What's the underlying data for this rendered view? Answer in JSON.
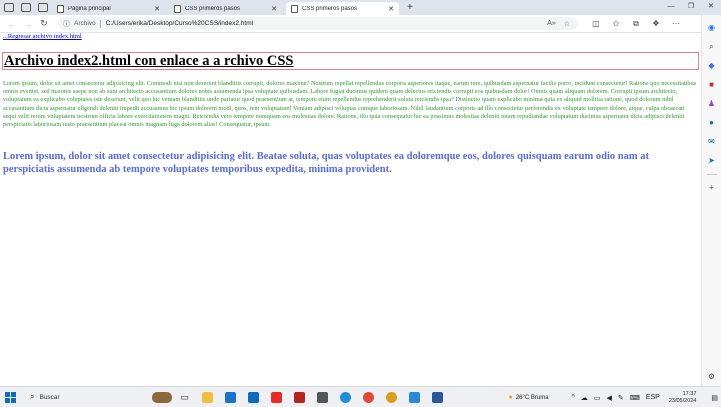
{
  "browser": {
    "tabs": [
      {
        "label": "Página principal",
        "active": false
      },
      {
        "label": "CSS primeros pasos",
        "active": false
      },
      {
        "label": "CSS primeros pasos",
        "active": true
      }
    ],
    "address": {
      "site_label": "Archivo",
      "url": "C:/Users/erika/Desktop/Curso%20CSS/index2.html"
    }
  },
  "page": {
    "back_link": "...Regresar archivo index.html",
    "heading": "Archivo index2.html con enlace a a rchivo CSS",
    "paragraph_green": "Lorem ipsum, dolor sit amet consectetur adipisicing elit. Commodi nisi non deserunt blanditiis corrupti, dolores maxime? Nostrum repellat repellendus corporis asperiores itaque, earum iure, quibusdam aspernatur facilis porro, incidunt consectetur! Ratione quo necessitatibus omnis eveniet, sed maiores saepe non ab sunt architecto accusantium dolores nobis assumenda ipsa voluptate quibusdam. Labore fugiat ducimus quidem quam delectus reiciendis corrupti eos quibusdam dolor! Omnis quam aliquam dolorem. Corrupti ipsum architecto, voluptatum ea explicabo voluptates iste deserunt, velit quo hic veniam blanditiis unde pariatur quod praesentium at, tempore enim repellendus reprehenderit soluta reiciendis ipsa? Distinctio quam explicabo minima quia ex aliquid mollitia ratione, quod dolorum nihil accusantium dicta aspernatur eligendi deleniti impedit accusamus hic ipsum dolorem modi, quos, rem voluptatum! Veniam adipisci voluptas cumque laboriosam. Nihil laudantium corporis ad illo consectetur perferendis ex voluptate tempore dolore, atque, culpa obcaecati sequi velit rerum voluptatem nostrum officia labore exercitationem magni. Reiciendis vero tempore numquam eos molestias dolore. Ratione, illo quia consequatur hic ea possimus molestias deleniti totam repudiandae voluptatum ducimus aspernatur dicta adipisci deleniti perspiciatis laboriosam iusto praesentium placeat omnis magnam fuga dolorem alias! Consequatur, ipsum.",
    "paragraph_blue": "Lorem ipsum, dolor sit amet consectetur adipisicing elit. Beatae soluta, quas voluptates ea doloremque eos, dolores quisquam earum odio nam at perspiciatis assumenda ab tempore voluptates temporibus expedita, minima provident."
  },
  "taskbar": {
    "search_label": "Buscar",
    "weather": "26°C Bruma",
    "language": "ESP",
    "time": "17:37",
    "date": "23/05/2024"
  },
  "colors": {
    "heading_border": "#e7808a",
    "green_text": "#2e9a2e",
    "blue_text": "#5a6be0",
    "link": "#0000ee"
  }
}
